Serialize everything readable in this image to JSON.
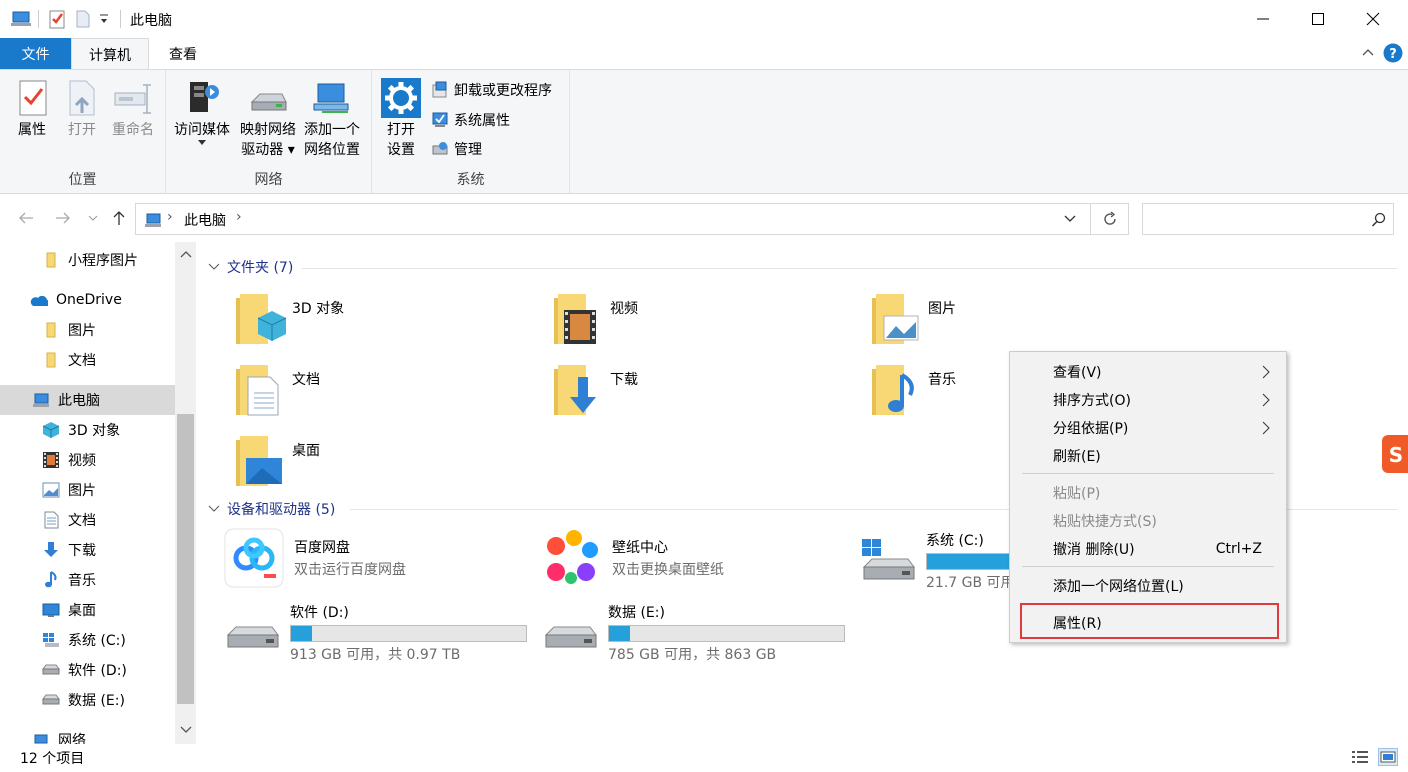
{
  "window": {
    "title": "此电脑",
    "buttons": {
      "minimize": "minimize",
      "maximize": "maximize",
      "close": "close"
    }
  },
  "ribbon_tabs": {
    "file": "文件",
    "computer": "计算机",
    "view": "查看"
  },
  "ribbon": {
    "location_group": {
      "label": "位置",
      "properties": "属性",
      "open": "打开",
      "rename": "重命名"
    },
    "network_group": {
      "label": "网络",
      "access_media": "访问媒体",
      "map_drive_1": "映射网络",
      "map_drive_2": "驱动器",
      "add_location_1": "添加一个",
      "add_location_2": "网络位置"
    },
    "system_group": {
      "label": "系统",
      "open_settings_1": "打开",
      "open_settings_2": "设置",
      "uninstall": "卸载或更改程序",
      "system_properties": "系统属性",
      "manage": "管理"
    }
  },
  "address": {
    "location_icon": "computer-icon",
    "crumb": "此电脑",
    "separator": "›"
  },
  "nav_pane": {
    "items": [
      {
        "label": "小程序图片",
        "icon": "folder-icon"
      },
      {
        "label": "OneDrive",
        "icon": "onedrive-icon"
      },
      {
        "label": "图片",
        "icon": "folder-icon"
      },
      {
        "label": "文档",
        "icon": "folder-icon"
      },
      {
        "label": "此电脑",
        "icon": "computer-icon"
      },
      {
        "label": "3D 对象",
        "icon": "3d-objects-icon"
      },
      {
        "label": "视频",
        "icon": "videos-icon"
      },
      {
        "label": "图片",
        "icon": "pictures-icon"
      },
      {
        "label": "文档",
        "icon": "documents-icon"
      },
      {
        "label": "下载",
        "icon": "downloads-icon"
      },
      {
        "label": "音乐",
        "icon": "music-icon"
      },
      {
        "label": "桌面",
        "icon": "desktop-icon"
      },
      {
        "label": "系统 (C:)",
        "icon": "windows-drive-icon"
      },
      {
        "label": "软件 (D:)",
        "icon": "drive-icon"
      },
      {
        "label": "数据 (E:)",
        "icon": "drive-icon"
      },
      {
        "label": "网络",
        "icon": "network-icon"
      }
    ]
  },
  "content": {
    "folders_header": "文件夹 (7)",
    "folders": [
      {
        "name": "3D 对象"
      },
      {
        "name": "视频"
      },
      {
        "name": "图片"
      },
      {
        "name": "文档"
      },
      {
        "name": "下载"
      },
      {
        "name": "音乐"
      },
      {
        "name": "桌面"
      }
    ],
    "devices_header": "设备和驱动器 (5)",
    "apps": [
      {
        "name": "百度网盘",
        "desc": "双击运行百度网盘"
      },
      {
        "name": "壁纸中心",
        "desc": "双击更换桌面壁纸"
      }
    ],
    "drives": [
      {
        "name": "系统 (C:)",
        "free": "21.7 GB 可用",
        "usage_fraction": 0.72
      },
      {
        "name": "软件 (D:)",
        "free": "913 GB 可用，共 0.97 TB",
        "usage_fraction": 0.09
      },
      {
        "name": "数据 (E:)",
        "free": "785 GB 可用，共 863 GB",
        "usage_fraction": 0.09
      }
    ]
  },
  "context_menu": {
    "view": "查看(V)",
    "sort": "排序方式(O)",
    "group": "分组依据(P)",
    "refresh": "刷新(E)",
    "paste": "粘贴(P)",
    "paste_shortcut": "粘贴快捷方式(S)",
    "undo": "撤消 删除(U)",
    "undo_key": "Ctrl+Z",
    "add_network": "添加一个网络位置(L)",
    "properties": "属性(R)"
  },
  "status_bar": {
    "count": "12 个项目"
  },
  "colors": {
    "accent": "#1979ca",
    "highlight_box": "#e0393e",
    "drive_bar": "#26a0da",
    "folder": "#f8d775"
  }
}
